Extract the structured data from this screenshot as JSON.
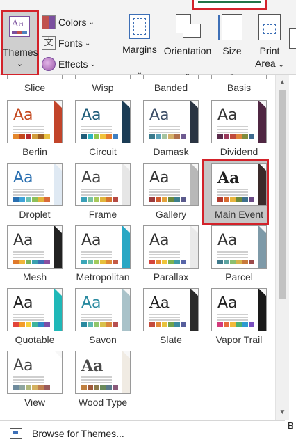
{
  "ribbon": {
    "themes_label": "Themes",
    "colors_label": "Colors",
    "fonts_label": "Fonts",
    "effects_label": "Effects",
    "margins_label": "Margins",
    "orientation_label": "Orientation",
    "size_label": "Size",
    "print_label": "Print",
    "area_label": "Area",
    "right_edge_label": "B"
  },
  "gallery": {
    "partial_row": [
      "Slice",
      "Wisp",
      "Banded",
      "Basis"
    ],
    "themes": [
      {
        "name": "Berlin",
        "aa_color": "#c4481e",
        "swatches": [
          "#e4872c",
          "#c4481e",
          "#b7282c",
          "#d19b3b",
          "#9e5c1f",
          "#e8c041"
        ],
        "deco": "#c2442a"
      },
      {
        "name": "Circuit",
        "aa_color": "#1f5d7a",
        "swatches": [
          "#1f5d7a",
          "#2bb3c0",
          "#8fc74d",
          "#f1c23b",
          "#e57b2e",
          "#3e7fc2"
        ],
        "deco": "#1b3c55"
      },
      {
        "name": "Damask",
        "aa_color": "#3c4d66",
        "swatches": [
          "#3a7a8c",
          "#5ba3b8",
          "#a5c4a0",
          "#d4b06a",
          "#b0704b",
          "#6e5a91"
        ],
        "deco": "#2a3442"
      },
      {
        "name": "Dividend",
        "aa_color": "#333333",
        "swatches": [
          "#5c2b4c",
          "#9c3a5c",
          "#c04b3d",
          "#e0873b",
          "#7f8c3d",
          "#3e6a8e"
        ],
        "deco": "#4f2642"
      },
      {
        "name": "Droplet",
        "aa_color": "#2a6fb0",
        "swatches": [
          "#2a6fb0",
          "#3fa3d8",
          "#6cc1b4",
          "#8dc05a",
          "#e2b33b",
          "#d96a3a"
        ],
        "deco": "#dfe9f3"
      },
      {
        "name": "Frame",
        "aa_color": "#444444",
        "swatches": [
          "#3ba0b8",
          "#7cc3a0",
          "#a8c95b",
          "#e0b53c",
          "#d6742f",
          "#b64a43"
        ],
        "deco": "#e6e6e6"
      },
      {
        "name": "Gallery",
        "aa_color": "#333333",
        "swatches": [
          "#9c3b3b",
          "#d05a2e",
          "#e2a23c",
          "#6b8a3e",
          "#3e7f8c",
          "#5a5a8c"
        ],
        "deco": "#b8b8b8"
      },
      {
        "name": "Main Event",
        "aa_color": "#222222",
        "swatches": [
          "#b33b2e",
          "#d86b30",
          "#e8b53e",
          "#6e8a3a",
          "#3d6f8c",
          "#6a4a86"
        ],
        "deco": "#3a2a2a"
      },
      {
        "name": "Mesh",
        "aa_color": "#333333",
        "swatches": [
          "#e07a2c",
          "#f0b43a",
          "#7ab35a",
          "#3aa0b0",
          "#3d6fb6",
          "#8a4fa0"
        ],
        "deco": "#222222"
      },
      {
        "name": "Metropolitan",
        "aa_color": "#333333",
        "swatches": [
          "#3aa6b8",
          "#6cc0a5",
          "#a2cc5c",
          "#e6c03c",
          "#e08a35",
          "#c55a45"
        ],
        "deco": "#29a7c4"
      },
      {
        "name": "Parallax",
        "aa_color": "#333333",
        "swatches": [
          "#d4453c",
          "#e98a2e",
          "#f0c53a",
          "#7bb24f",
          "#3f9aa5",
          "#5865a8"
        ],
        "deco": "#e9e9e9"
      },
      {
        "name": "Parcel",
        "aa_color": "#333333",
        "swatches": [
          "#3f7a8c",
          "#5ca4a0",
          "#8cbf70",
          "#d8b44a",
          "#c87a3c",
          "#9c4a4a"
        ],
        "deco": "#7e9aa8"
      },
      {
        "name": "Quotable",
        "aa_color": "#222222",
        "swatches": [
          "#e2453a",
          "#f39c2a",
          "#f6d03a",
          "#3fb59c",
          "#2e88c8",
          "#7c4fa8"
        ],
        "deco": "#1fb8b8"
      },
      {
        "name": "Savon",
        "aa_color": "#2a8aa0",
        "swatches": [
          "#2a8aa0",
          "#5cb8b0",
          "#90c66a",
          "#d8c04a",
          "#d9883c",
          "#b85050"
        ],
        "deco": "#a9c2c9"
      },
      {
        "name": "Slate",
        "aa_color": "#222222",
        "swatches": [
          "#c44b3c",
          "#e38a36",
          "#e8c23c",
          "#6fa24c",
          "#3b8aa0",
          "#565e9c"
        ],
        "deco": "#2b2b2b"
      },
      {
        "name": "Vapor Trail",
        "aa_color": "#222222",
        "swatches": [
          "#d43a7c",
          "#e86a3a",
          "#f2b93a",
          "#4cb070",
          "#2e9ad0",
          "#7a4fc0"
        ],
        "deco": "#1a1a1a"
      },
      {
        "name": "View",
        "aa_color": "#444444",
        "swatches": [
          "#6e8a9c",
          "#8fa6a0",
          "#b0b87a",
          "#d4b160",
          "#c08050",
          "#9a5a5a"
        ],
        "deco": "#ffffff"
      },
      {
        "name": "Wood Type",
        "aa_color": "#4a4a4a",
        "swatches": [
          "#c08040",
          "#a05a3a",
          "#8c7a4a",
          "#6a8a5a",
          "#5a7a8a",
          "#8a5a7a"
        ],
        "deco": "#f0ebe3"
      }
    ],
    "selected": "Main Event"
  },
  "footer": {
    "browse_label": "Browse for Themes..."
  }
}
